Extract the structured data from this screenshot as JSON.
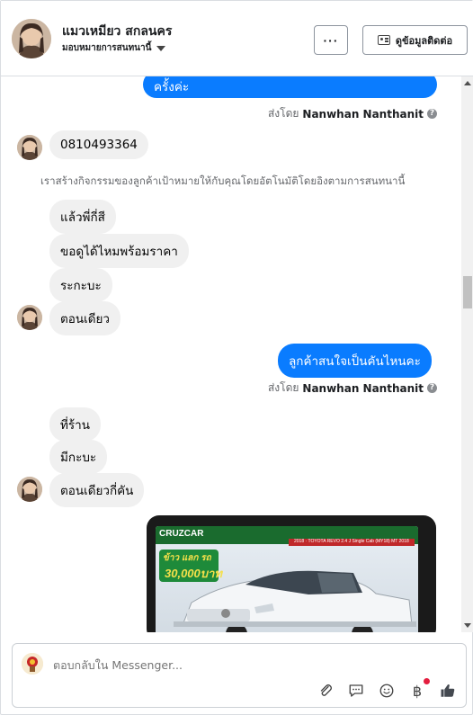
{
  "header": {
    "contact_name": "แมวเหมียว สกลนคร",
    "assign_label": "มอบหมายการสนทนานี้",
    "more_label": "···",
    "contact_info_label": "ดูข้อมูลติดต่อ"
  },
  "messages": {
    "out_1": "ครั้งค่ะ",
    "sent_by_prefix": "ส่งโดย",
    "sent_by_name": "Nanwhan Nanthanit",
    "in_phone": "0810493364",
    "system_note": "เราสร้างกิจกรรมของลูกค้าเป้าหมายให้กับคุณโดยอัตโนมัติโดยอิงตามการสนทนานี้",
    "in_1": "แล้วพี่กี่สี",
    "in_2": "ขอดูได้ไหมพร้อมราคา",
    "in_3": "ระกะบะ",
    "in_4": "ตอนเดียว",
    "out_2": "ลูกค้าสนใจเป็นคันไหนคะ",
    "in_5": "ที่ร้าน",
    "in_6": "มีกะบะ",
    "in_7": "ตอนเดียวกี่คัน"
  },
  "attachment": {
    "banner": "CRUZCAR",
    "strip": "2018 · TOYOTA REVO 2.4 J Single Cab (MY18) MT 2018",
    "promo_line1": "ข้าว แลก รถ",
    "promo_line2": "30,000บาท"
  },
  "composer": {
    "placeholder": "ตอบกลับใน Messenger..."
  },
  "colors": {
    "outgoing_bubble": "#0a7cff",
    "incoming_bubble": "#f0f0f0",
    "like_icon": "#444950",
    "notification_dot": "#e41e3f"
  }
}
